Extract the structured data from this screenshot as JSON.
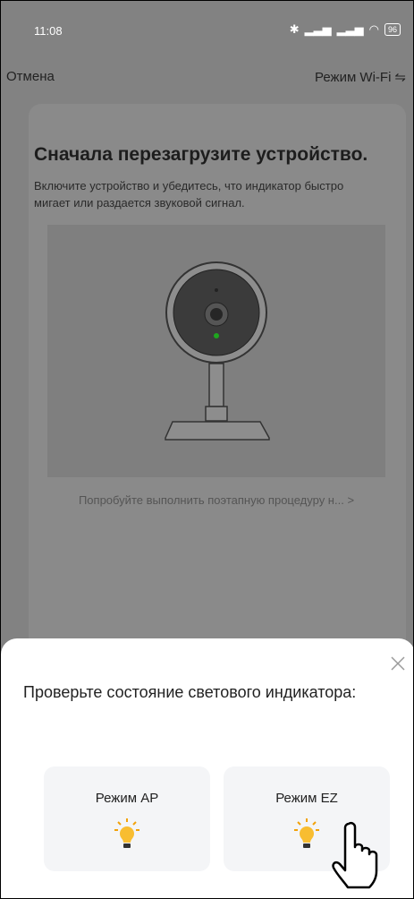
{
  "status_bar": {
    "time": "11:08",
    "battery": "96"
  },
  "header": {
    "cancel_label": "Отмена",
    "mode_label": "Режим Wi-Fi"
  },
  "card": {
    "title": "Сначала перезагрузите устройство.",
    "description": "Включите устройство и убедитесь, что индикатор быстро мигает или раздается звуковой сигнал.",
    "link": "Попробуйте выполнить поэтапную процедуру н...  >"
  },
  "sheet": {
    "title": "Проверьте состояние светового индикатора:",
    "options": [
      {
        "label": "Режим AP",
        "icon": "bulb-icon"
      },
      {
        "label": "Режим EZ",
        "icon": "bulb-icon"
      }
    ]
  }
}
